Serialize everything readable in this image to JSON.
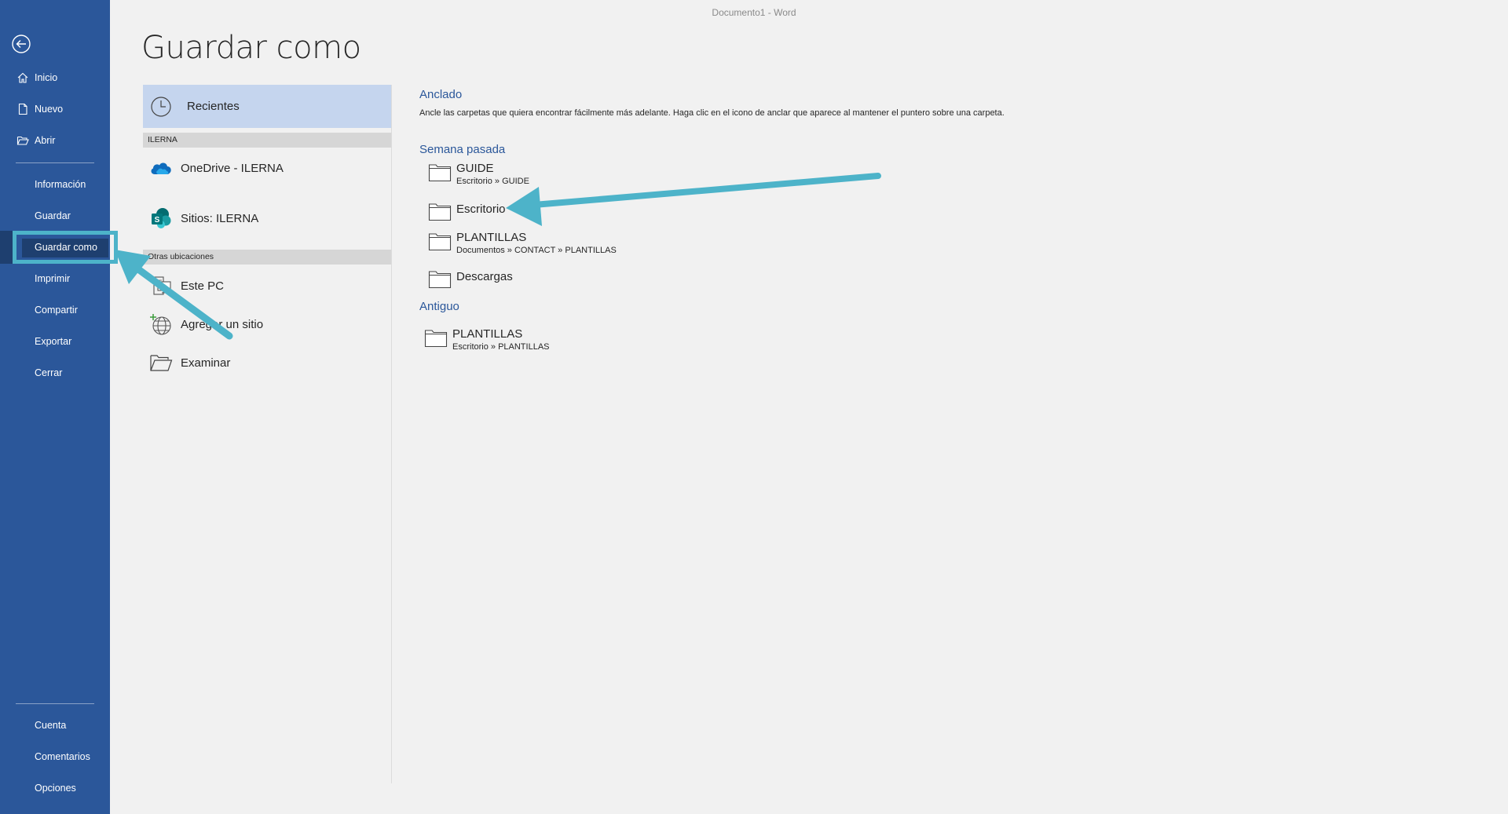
{
  "window": {
    "title": "Documento1  -  Word"
  },
  "page": {
    "title": "Guardar como"
  },
  "sidebar": {
    "items": [
      {
        "label": "Inicio"
      },
      {
        "label": "Nuevo"
      },
      {
        "label": "Abrir"
      },
      {
        "label": "Información"
      },
      {
        "label": "Guardar"
      },
      {
        "label": "Guardar como"
      },
      {
        "label": "Imprimir"
      },
      {
        "label": "Compartir"
      },
      {
        "label": "Exportar"
      },
      {
        "label": "Cerrar"
      },
      {
        "label": "Cuenta"
      },
      {
        "label": "Comentarios"
      },
      {
        "label": "Opciones"
      }
    ],
    "active": "Guardar como"
  },
  "locations": {
    "recent": "Recientes",
    "group_ilerna": "ILERNA",
    "onedrive": "OneDrive - ILERNA",
    "sites": "Sitios: ILERNA",
    "group_other": "Otras ubicaciones",
    "this_pc": "Este PC",
    "add_place": "Agregar un sitio",
    "browse": "Examinar"
  },
  "content": {
    "pinned": {
      "title": "Anclado",
      "description": "Ancle las carpetas que quiera encontrar fácilmente más adelante. Haga clic en el icono de anclar que aparece al mantener el puntero sobre una carpeta."
    },
    "last_week": {
      "title": "Semana pasada",
      "folders": [
        {
          "name": "GUIDE",
          "path": "Escritorio » GUIDE"
        },
        {
          "name": "Escritorio",
          "path": ""
        },
        {
          "name": "PLANTILLAS",
          "path": "Documentos » CONTACT » PLANTILLAS"
        },
        {
          "name": "Descargas",
          "path": ""
        }
      ]
    },
    "older": {
      "title": "Antiguo",
      "folders": [
        {
          "name": "PLANTILLAS",
          "path": "Escritorio » PLANTILLAS"
        }
      ]
    }
  },
  "colors": {
    "sidebar": "#2b579a",
    "active_item": "#1e3f6f",
    "annotation": "#4db3c9",
    "selected_location": "#c5d5ee",
    "section_title": "#2b579a"
  },
  "icons": [
    "back-arrow-icon",
    "home-icon",
    "new-doc-icon",
    "open-folder-icon",
    "clock-icon",
    "onedrive-cloud-icon",
    "sharepoint-icon",
    "pc-icon",
    "globe-icon",
    "folder-icon"
  ]
}
